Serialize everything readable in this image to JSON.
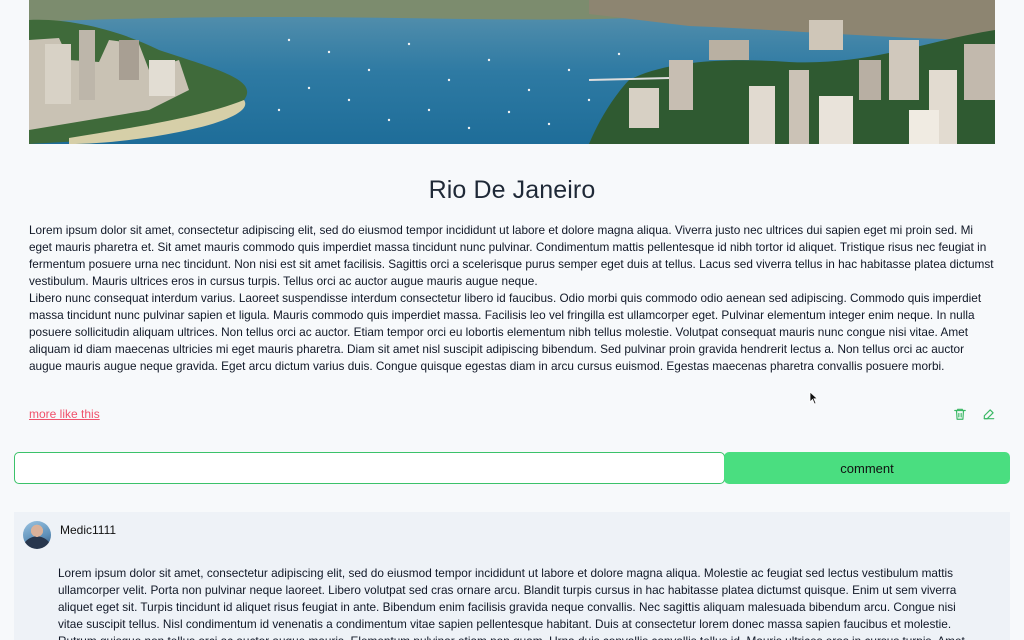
{
  "post": {
    "title": "Rio De Janeiro",
    "paragraphs": [
      "Lorem ipsum dolor sit amet, consectetur adipiscing elit, sed do eiusmod tempor incididunt ut labore et dolore magna aliqua. Viverra justo nec ultrices dui sapien eget mi proin sed. Mi eget mauris pharetra et. Sit amet mauris commodo quis imperdiet massa tincidunt nunc pulvinar. Condimentum mattis pellentesque id nibh tortor id aliquet. Tristique risus nec feugiat in fermentum posuere urna nec tincidunt. Non nisi est sit amet facilisis. Sagittis orci a scelerisque purus semper eget duis at tellus. Lacus sed viverra tellus in hac habitasse platea dictumst vestibulum. Mauris ultrices eros in cursus turpis. Tellus orci ac auctor augue mauris augue neque.",
      "Libero nunc consequat interdum varius. Laoreet suspendisse interdum consectetur libero id faucibus. Odio morbi quis commodo odio aenean sed adipiscing. Commodo quis imperdiet massa tincidunt nunc pulvinar sapien et ligula. Mauris commodo quis imperdiet massa. Facilisis leo vel fringilla est ullamcorper eget. Pulvinar elementum integer enim neque. In nulla posuere sollicitudin aliquam ultrices. Non tellus orci ac auctor. Etiam tempor orci eu lobortis elementum nibh tellus molestie. Volutpat consequat mauris nunc congue nisi vitae. Amet aliquam id diam maecenas ultricies mi eget mauris pharetra. Diam sit amet nisl suscipit adipiscing bibendum. Sed pulvinar proin gravida hendrerit lectus a. Non tellus orci ac auctor augue mauris augue neque gravida. Eget arcu dictum varius duis. Congue quisque egestas diam in arcu cursus euismod. Egestas maecenas pharetra convallis posuere morbi."
    ],
    "more_link": "more like this",
    "delete_icon": "trash-icon",
    "edit_icon": "pencil-icon"
  },
  "comment_form": {
    "input_value": "",
    "input_placeholder": "",
    "button_label": "comment"
  },
  "comments": [
    {
      "username": "Medic1111",
      "text": "Lorem ipsum dolor sit amet, consectetur adipiscing elit, sed do eiusmod tempor incididunt ut labore et dolore magna aliqua. Molestie ac feugiat sed lectus vestibulum mattis ullamcorper velit. Porta non pulvinar neque laoreet. Libero volutpat sed cras ornare arcu. Blandit turpis cursus in hac habitasse platea dictumst quisque. Enim ut sem viverra aliquet eget sit. Turpis tincidunt id aliquet risus feugiat in ante. Bibendum enim facilisis gravida neque convallis. Nec sagittis aliquam malesuada bibendum arcu. Congue nisi vitae suscipit tellus. Nisl condimentum id venenatis a condimentum vitae sapien pellentesque habitant. Duis at consectetur lorem donec massa sapien faucibus et molestie. Rutrum quisque non tellus orci ac auctor augue mauris. Elementum pulvinar etiam non quam. Urna duis convallis convallis tellus id. Mauris ultrices eros in cursus turpis. Amet"
    }
  ],
  "colors": {
    "accent_green": "#4ade80",
    "link_red": "#f0516b",
    "icon_green": "#3bb865"
  }
}
